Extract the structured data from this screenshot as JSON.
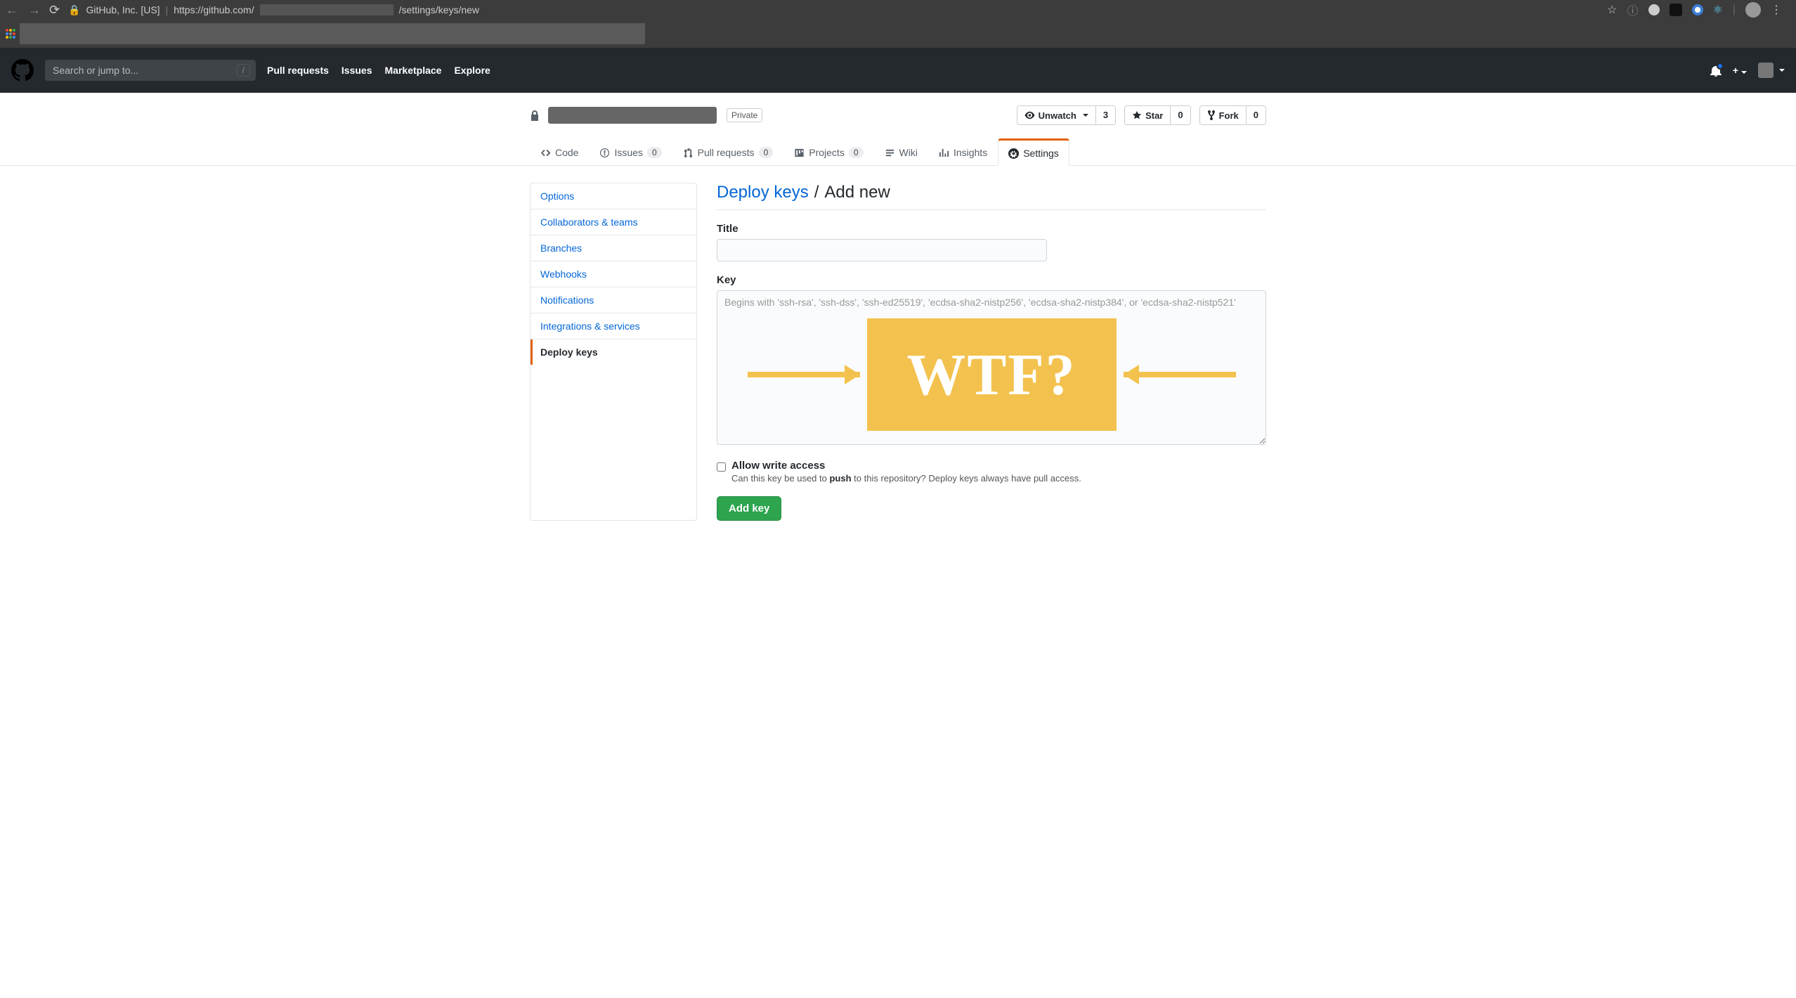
{
  "browser": {
    "secure_label": "GitHub, Inc. [US]",
    "url_before": "https://github.com/",
    "url_after": "/settings/keys/new",
    "star_icon": "star",
    "menu_icon": "menu"
  },
  "gh_header": {
    "search_placeholder": "Search or jump to...",
    "slash": "/",
    "nav": {
      "pull_requests": "Pull requests",
      "issues": "Issues",
      "marketplace": "Marketplace",
      "explore": "Explore"
    },
    "plus": "+"
  },
  "repo": {
    "private_label": "Private",
    "unwatch": {
      "label": "Unwatch",
      "count": "3"
    },
    "star": {
      "label": "Star",
      "count": "0"
    },
    "fork": {
      "label": "Fork",
      "count": "0"
    }
  },
  "tabs": {
    "code": "Code",
    "issues": {
      "label": "Issues",
      "count": "0"
    },
    "pulls": {
      "label": "Pull requests",
      "count": "0"
    },
    "projects": {
      "label": "Projects",
      "count": "0"
    },
    "wiki": "Wiki",
    "insights": "Insights",
    "settings": "Settings"
  },
  "sidebar": {
    "items": {
      "options": "Options",
      "collaborators": "Collaborators & teams",
      "branches": "Branches",
      "webhooks": "Webhooks",
      "notifications": "Notifications",
      "integrations": "Integrations & services",
      "deploy_keys": "Deploy keys"
    }
  },
  "main": {
    "breadcrumb_link": "Deploy keys",
    "breadcrumb_sep": "/",
    "breadcrumb_current": "Add new",
    "title_label": "Title",
    "title_value": "",
    "key_label": "Key",
    "key_value": "",
    "key_placeholder": "Begins with 'ssh-rsa', 'ssh-dss', 'ssh-ed25519', 'ecdsa-sha2-nistp256', 'ecdsa-sha2-nistp384', or 'ecdsa-sha2-nistp521'",
    "allow_write_label": "Allow write access",
    "allow_write_hint_pre": "Can this key be used to ",
    "allow_write_hint_bold": "push",
    "allow_write_hint_post": " to this repository? Deploy keys always have pull access.",
    "submit_label": "Add key"
  },
  "annotation": {
    "wtf": "WTF?"
  }
}
